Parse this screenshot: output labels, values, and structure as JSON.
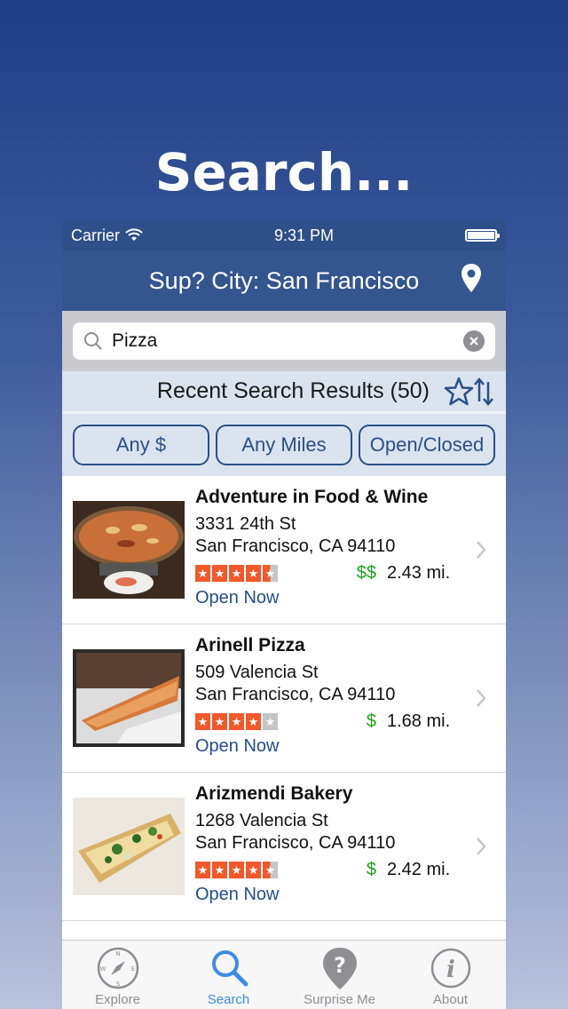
{
  "hero": {
    "title": "Search..."
  },
  "statusbar": {
    "carrier": "Carrier",
    "time": "9:31 PM"
  },
  "navbar": {
    "title": "Sup? City:  San Francisco",
    "location_icon": "map-pin-icon"
  },
  "search": {
    "value": "Pizza",
    "clear_icon": "clear-icon"
  },
  "results_header": {
    "title": "Recent Search Results (50)",
    "sort_icon": "star-sort-icon"
  },
  "filters": [
    {
      "label": "Any $"
    },
    {
      "label": "Any Miles"
    },
    {
      "label": "Open/Closed"
    }
  ],
  "results": [
    {
      "name": "Adventure in Food & Wine",
      "address1": "3331 24th St",
      "address2": "San Francisco, CA 94110",
      "rating": 4.5,
      "price": "$$",
      "distance": "2.43 mi.",
      "status": "Open Now"
    },
    {
      "name": "Arinell Pizza",
      "address1": "509 Valencia St",
      "address2": "San Francisco, CA 94110",
      "rating": 4,
      "price": "$",
      "distance": "1.68 mi.",
      "status": "Open Now"
    },
    {
      "name": "Arizmendi Bakery",
      "address1": "1268 Valencia St",
      "address2": "San Francisco, CA 94110",
      "rating": 4.5,
      "price": "$",
      "distance": "2.42 mi.",
      "status": "Open Now"
    }
  ],
  "tabs": [
    {
      "label": "Explore",
      "icon": "compass-icon",
      "active": false
    },
    {
      "label": "Search",
      "icon": "search-icon",
      "active": true
    },
    {
      "label": "Surprise Me",
      "icon": "question-pin-icon",
      "active": false
    },
    {
      "label": "About",
      "icon": "info-icon",
      "active": false
    }
  ],
  "colors": {
    "nav_blue": "#33568f",
    "star_red": "#f2582a",
    "price_green": "#1aa41a",
    "open_blue": "#234e8c",
    "tab_active": "#3c8ce7"
  }
}
